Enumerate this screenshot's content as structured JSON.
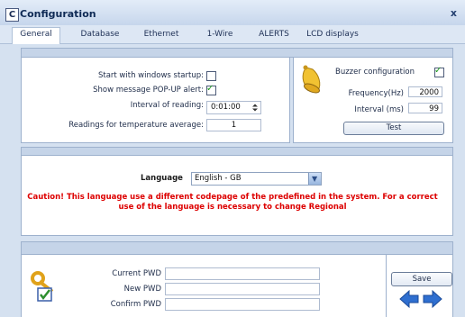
{
  "window": {
    "icon_letter": "C",
    "title": "Configuration",
    "close_glyph": "x"
  },
  "tabs": [
    {
      "label": "General",
      "active": true
    },
    {
      "label": "Database"
    },
    {
      "label": "Ethernet"
    },
    {
      "label": "1-Wire"
    },
    {
      "label": "ALERTS"
    },
    {
      "label": "LCD displays"
    }
  ],
  "general": {
    "startup_label": "Start with windows startup:",
    "startup_checked": false,
    "popup_label": "Show message POP-UP alert:",
    "popup_checked": true,
    "interval_label": "Interval of reading:",
    "interval_value": "0:01:00",
    "avg_label": "Readings for temperature average:",
    "avg_value": "1"
  },
  "buzzer": {
    "label": "Buzzer configuration",
    "checked": true,
    "frequency_label": "Frequency(Hz)",
    "frequency_value": "2000",
    "interval_label": "Interval (ms)",
    "interval_value": "99",
    "test_label": "Test"
  },
  "language": {
    "label": "Language",
    "selected": "English - GB",
    "caution": "Caution! This language use a different codepage of the predefined in the system. For a correct use of the language is necessary to change Regional"
  },
  "password": {
    "current_label": "Current PWD",
    "new_label": "New PWD",
    "confirm_label": "Confirm PWD",
    "save_label": "Save"
  },
  "colors": {
    "caution": "#dd0000",
    "check": "#1e9a1e",
    "arrow": "#2f6fd0"
  }
}
